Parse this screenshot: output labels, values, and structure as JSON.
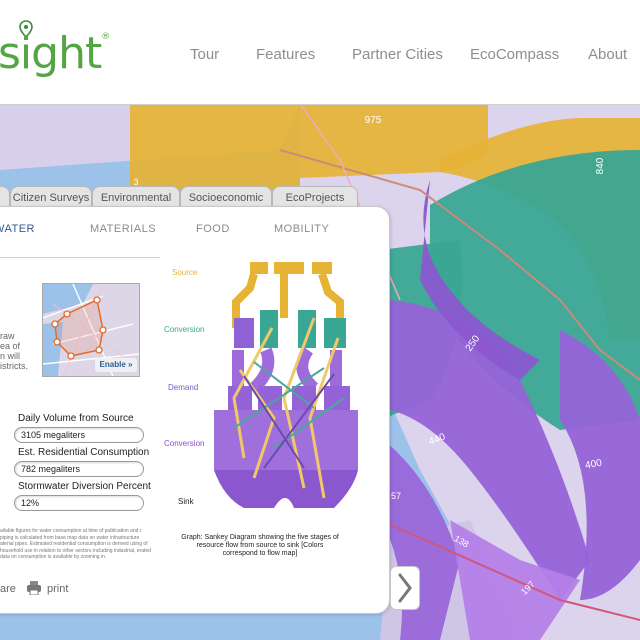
{
  "brand": {
    "logo_text": "sight",
    "logo_mark": "®"
  },
  "nav": {
    "items": [
      "Tour",
      "Features",
      "Partner Cities",
      "EcoCompass",
      "About"
    ]
  },
  "map": {
    "flow_labels": [
      "975",
      "840",
      "250",
      "440",
      "400",
      "57",
      "138",
      "197",
      "3"
    ],
    "colors": {
      "gold": "#e6b335",
      "teal": "#3aa795",
      "purple": "#9563d8",
      "water": "#9cc2ea",
      "land": "#dcd3ec",
      "road": "#d2567b"
    }
  },
  "panel": {
    "tabs": [
      "Citizen Surveys",
      "Environmental",
      "Socioeconomic",
      "EcoProjects"
    ],
    "subtabs": [
      "WATER",
      "MATERIALS",
      "FOOD",
      "MOBILITY"
    ],
    "draw_fragment": [
      "raw",
      "ea of",
      "n will",
      "istricts."
    ],
    "enable_button": "Enable »",
    "fields": [
      {
        "label": "Daily Volume from Source",
        "value": "3105 megaliters"
      },
      {
        "label": "Est. Residential Consumption",
        "value": "782 megaliters"
      },
      {
        "label": "Stormwater Diversion Percent",
        "value": "12%"
      }
    ],
    "fine_print": "ailable figures for water consumption at time of publication and r piping is calculated from base map data on water infrastructure aterial pipes. Estimated residential consumption is derived using of household use in relation to other sectors including industrial, erated data on consumption is available by zooming in.",
    "sankey_labels": [
      "Source",
      "Conversion",
      "Demand",
      "Conversion",
      "Sink"
    ],
    "sankey_label_colors": [
      "#e6b335",
      "#3aa795",
      "#7b58c9",
      "#8a4fc9",
      "#222222"
    ],
    "caption": "Graph: Sankey Diagram showing the five stages of resource flow from source to sink [Colors correspond to flow map]",
    "share_label": "are",
    "print_label": "print"
  }
}
